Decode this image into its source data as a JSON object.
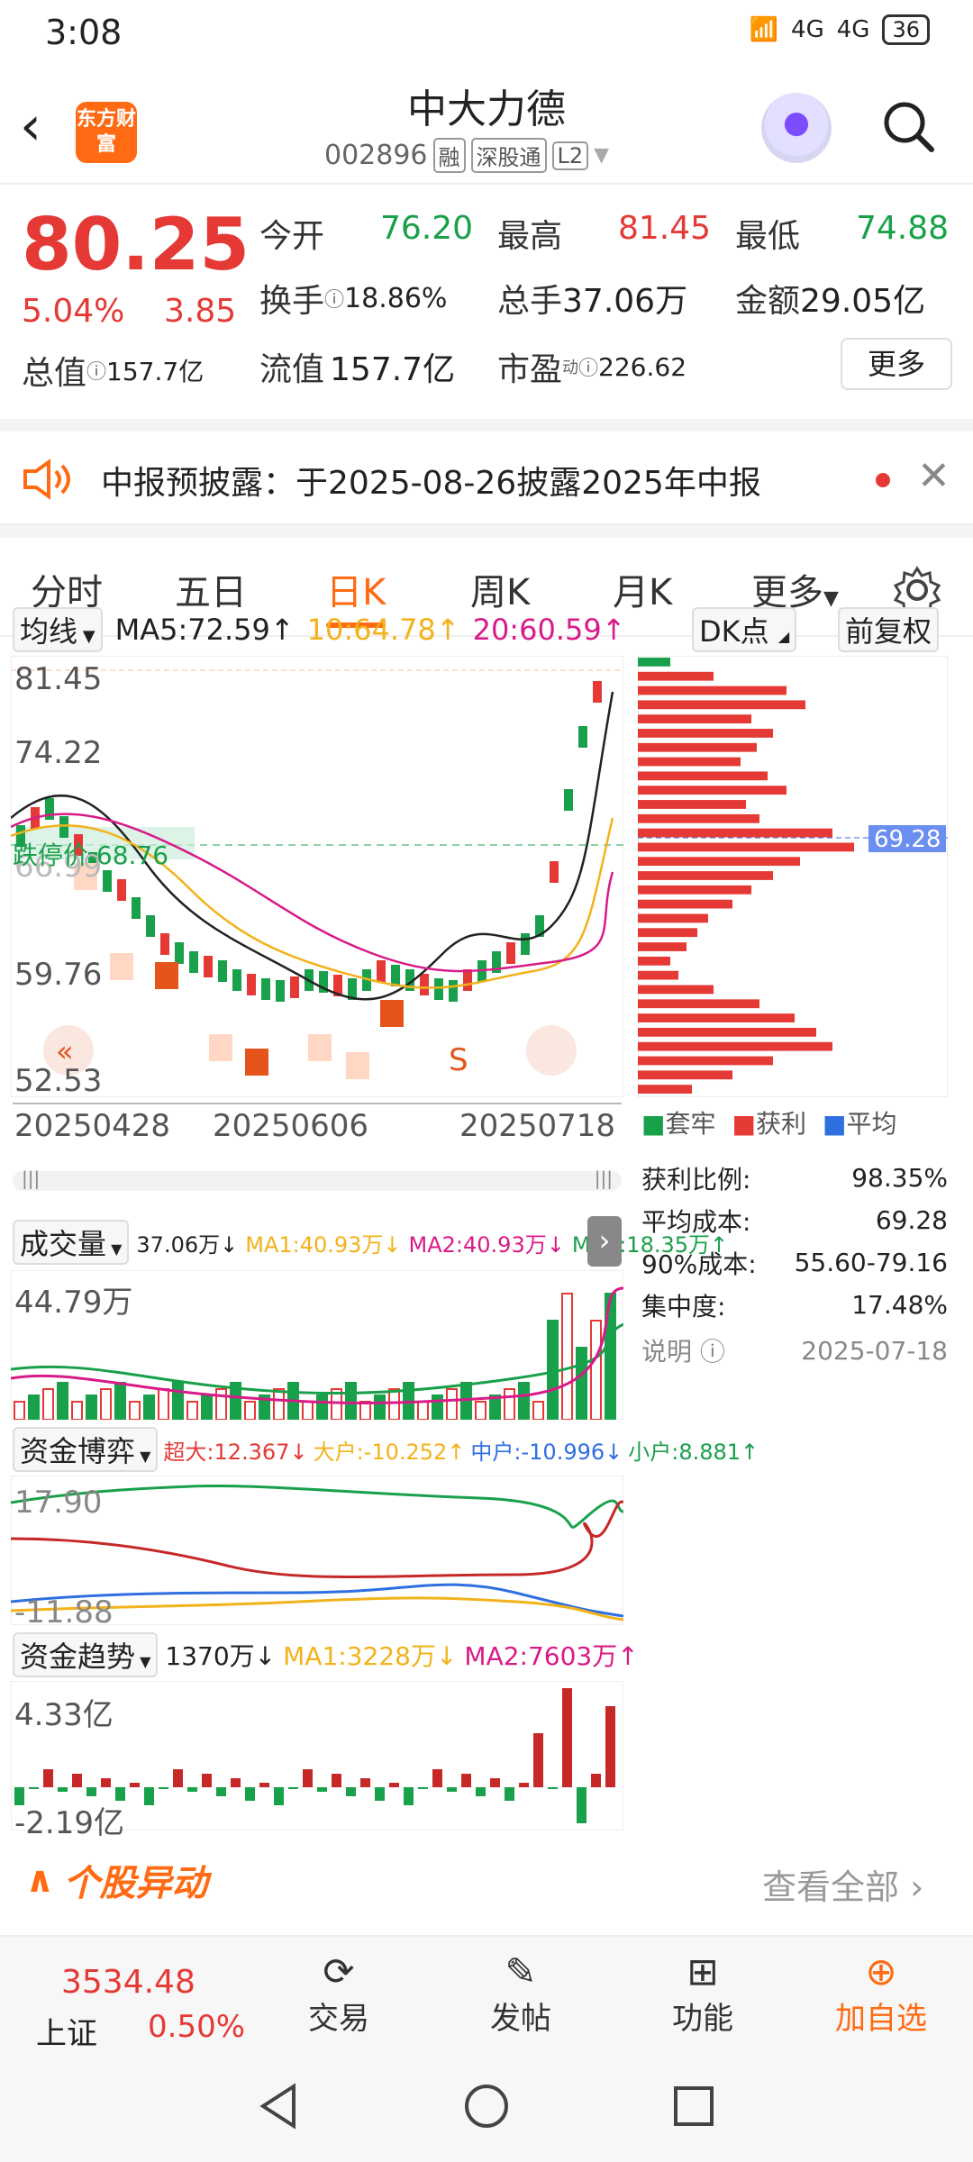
{
  "status": {
    "time": "3:08",
    "signal1": "4G",
    "signal2": "4G",
    "battery": "36"
  },
  "header": {
    "app_logo_text": "东方财富",
    "stock_name": "中大力德",
    "stock_code": "002896",
    "tags": [
      "融",
      "深股通",
      "L2"
    ]
  },
  "quote": {
    "price": "80.25",
    "change_pct": "5.04%",
    "change": "3.85",
    "open_label": "今开",
    "open": "76.20",
    "high_label": "最高",
    "high": "81.45",
    "low_label": "最低",
    "low": "74.88",
    "turnover_label": "换手",
    "turnover": "18.86%",
    "volume_label": "总手",
    "volume": "37.06万",
    "amount_label": "金额",
    "amount": "29.05亿",
    "mktcap_label": "总值",
    "mktcap": "157.7亿",
    "float_label": "流值",
    "float": "157.7亿",
    "pe_label": "市盈",
    "pe_sup": "动",
    "pe": "226.62",
    "more": "更多"
  },
  "notice": {
    "text": "中报预披露：于2025-08-26披露2025年中报"
  },
  "tabs": [
    "分时",
    "五日",
    "日K",
    "周K",
    "月K",
    "更多"
  ],
  "active_tab": "日K",
  "kline_toolbar": {
    "indicator": "均线",
    "ma5": "MA5:72.59↑",
    "ma10": "10:64.78↑",
    "ma20": "20:60.59↑",
    "dk": "DK点",
    "adjust": "前复权"
  },
  "kline_axis": {
    "y_ticks": [
      "81.45",
      "74.22",
      "66.99",
      "59.76",
      "52.53"
    ],
    "limit_label": "跌停价",
    "limit_value": "68.76",
    "x_ticks": [
      "20250428",
      "20250606",
      "20250718"
    ],
    "signal": "S"
  },
  "chip": {
    "avg_marker": "69.28",
    "legend": [
      "套牢",
      "获利",
      "平均"
    ],
    "rows": [
      {
        "label": "获利比例:",
        "value": "98.35%"
      },
      {
        "label": "平均成本:",
        "value": "69.28"
      },
      {
        "label": "90%成本:",
        "value": "55.60-79.16"
      },
      {
        "label": "集中度:",
        "value": "17.48%"
      }
    ],
    "note_label": "说明",
    "date": "2025-07-18"
  },
  "volume_panel": {
    "name": "成交量",
    "vol": "37.06万↓",
    "ma1": "MA1:40.93万↓",
    "ma2": "MA2:40.93万↓",
    "ma3": "MA3:18.35万↑",
    "top": "44.79万"
  },
  "fund_game": {
    "name": "资金博弈",
    "super": "超大:12.367↓",
    "big": "大户:-10.252↑",
    "mid": "中户:-10.996↓",
    "small": "小户:8.881↑",
    "top": "17.90",
    "bottom": "-11.88"
  },
  "fund_trend": {
    "name": "资金趋势",
    "val": "1370万↓",
    "ma1": "MA1:3228万↓",
    "ma2": "MA2:7603万↑",
    "top": "4.33亿",
    "bottom": "-2.19亿"
  },
  "movement": {
    "title": "个股异动",
    "view_all": "查看全部"
  },
  "bottom_nav": {
    "index_value": "3534.48",
    "index_name": "上证",
    "index_change": "0.50%",
    "trade": "交易",
    "post": "发帖",
    "func": "功能",
    "add": "加自选"
  },
  "colors": {
    "up": "#e53935",
    "down": "#19a04b",
    "accent": "#ff6a13"
  },
  "chart_data": [
    {
      "type": "bar",
      "title": "筹码分布",
      "categories": [
        "79.9",
        "79.0",
        "78.1",
        "77.2",
        "76.3",
        "75.4",
        "74.5",
        "73.6",
        "72.7",
        "71.8",
        "70.9",
        "70.0",
        "69.3",
        "68.4",
        "67.5",
        "66.6",
        "65.7",
        "64.8",
        "63.9",
        "63.0",
        "62.1",
        "61.2",
        "60.3",
        "59.4",
        "58.5",
        "57.6",
        "56.7",
        "55.8",
        "54.9",
        "54.0",
        "53.1"
      ],
      "values": [
        12,
        28,
        55,
        62,
        42,
        50,
        44,
        38,
        48,
        55,
        40,
        45,
        72,
        80,
        60,
        50,
        42,
        35,
        26,
        22,
        18,
        12,
        15,
        28,
        45,
        58,
        66,
        72,
        50,
        35,
        20
      ]
    }
  ]
}
